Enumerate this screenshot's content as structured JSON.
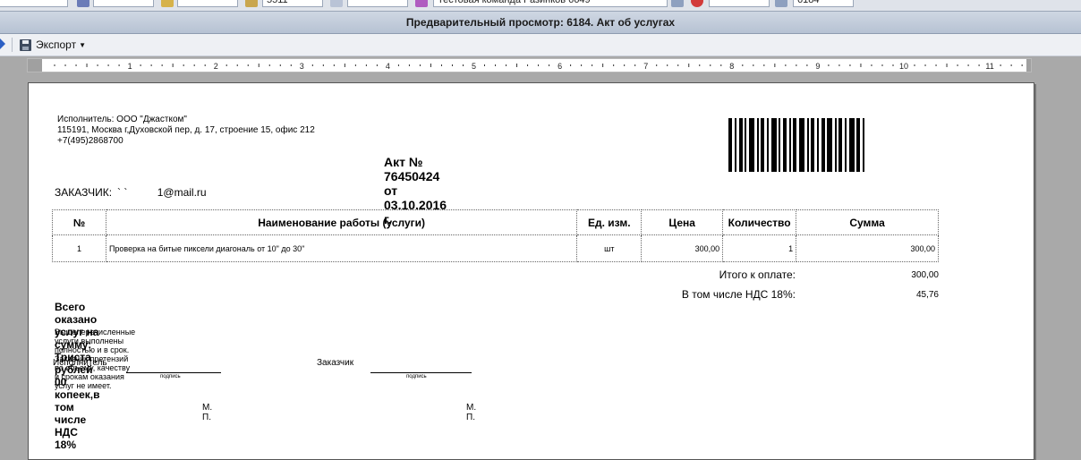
{
  "top_strip": {
    "field_1": "5511",
    "field_2": "Тестовая команда Разинков 6649",
    "field_3": "6184"
  },
  "window": {
    "title": "Предварительный просмотр: 6184. Акт об услугах"
  },
  "toolbar": {
    "export_label": "Экспорт"
  },
  "ruler": {
    "marks": [
      "1",
      "2",
      "3",
      "4",
      "5",
      "6",
      "7",
      "8",
      "9",
      "10",
      "11"
    ]
  },
  "document": {
    "executor_info": "Исполнитель: ООО \"Джастком\"\n115191, Москва г,Духовской пер, д. 17, строение 15, офис 212\n+7(495)2868700",
    "title": "Акт № 76450424 от 03.10.2016 г.",
    "customer_label": "ЗАКАЗЧИК:",
    "customer_value": "` `          1@mail.ru",
    "table": {
      "headers": [
        "№",
        "Наименование работы (услуги)",
        "Ед. изм.",
        "Цена",
        "Количество",
        "Сумма"
      ],
      "rows": [
        {
          "num": "1",
          "name": "Проверка на битые пиксели диагональ от 10\" до 30\"",
          "unit": "шт",
          "price": "300,00",
          "qty": "1",
          "sum": "300,00"
        }
      ]
    },
    "total_label": "Итого к оплате:",
    "total_value": "300,00",
    "vat_label": "В том числе НДС 18%:",
    "vat_value": "45,76",
    "sum_words": "Всего оказано услуг на сумму: Триста  рублей 00 копеек,в том числе НДС 18%",
    "note": "Вышеперечисленные услуги выполнены полностью и в срок. Заказчик претензий по объему, качеству и срокам оказания услуг не имеет.",
    "executor_sig_label": "Исполнитель",
    "customer_sig_label": "Заказчик",
    "signature_caption": "подпись",
    "stamp_label": "М. П."
  }
}
